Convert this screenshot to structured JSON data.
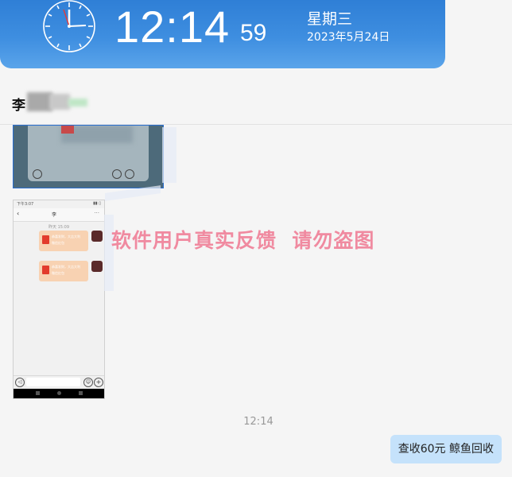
{
  "clock": {
    "time": "12:14",
    "seconds": "59",
    "weekday": "星期三",
    "date": "2023年5月24日"
  },
  "chat": {
    "contact_name": "李"
  },
  "attachments": [
    {
      "kind": "screenshot-image",
      "description_icon": "image"
    },
    {
      "kind": "phone-screenshot",
      "status_left": "下午3:07",
      "title": "李",
      "timestamp": "昨天 15:09",
      "red_packets": [
        {
          "line1": "恭喜发财，大吉大利",
          "line2": "微信红包"
        },
        {
          "line1": "恭喜发财，大吉大利",
          "line2": "微信红包"
        }
      ]
    }
  ],
  "watermark": "软件用户真实反馈  请勿盗图",
  "messages": {
    "timestamp": "12:14",
    "bubble_text": "查收60元 鲸鱼回收"
  },
  "colors": {
    "clock_bar": "#3e8ee0",
    "bubble": "#c5e2fb",
    "watermark": "#f08aa0"
  }
}
